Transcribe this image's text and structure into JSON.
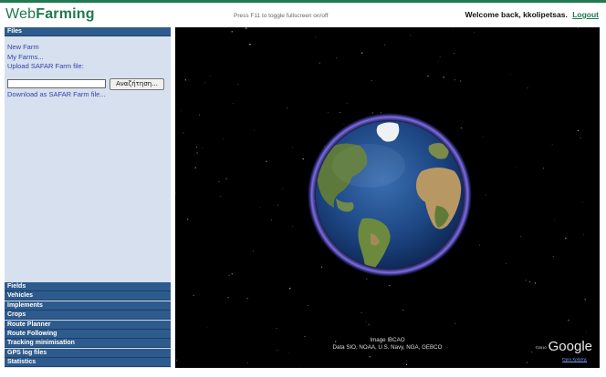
{
  "header": {
    "logo_part1": "Web",
    "logo_part2": "Farming",
    "fullscreen_hint": "Press F11 to toggle fullscreen on/off",
    "welcome_text": "Welcome back, kkolipetsas.",
    "logout_label": "Logout"
  },
  "sidebar": {
    "files_header": "Files",
    "new_farm": "New Farm",
    "my_farms": "My Farms...",
    "upload_label": "Upload SAFAR Farm file:",
    "browse_button": "Αναζήτηση...",
    "download_link": "Download as SAFAR Farm file...",
    "sections": [
      "Fields",
      "Vehicles",
      "Implements",
      "Crops",
      "Route Planner",
      "Route Following",
      "Tracking minimisation",
      "GPS log files",
      "Statistics"
    ]
  },
  "map": {
    "credit_line1": "Image IBCAO",
    "credit_line2": "Data SIO, NOAA, U.S. Navy, NGA, GEBCO",
    "copyright": "©2010",
    "google_logo": "Google",
    "terms": "Όροι Χρήσης"
  },
  "colors": {
    "accent_green": "#1f7a4f",
    "panel_bg": "#d6e0ee",
    "section_header": "#2d5b8d"
  }
}
